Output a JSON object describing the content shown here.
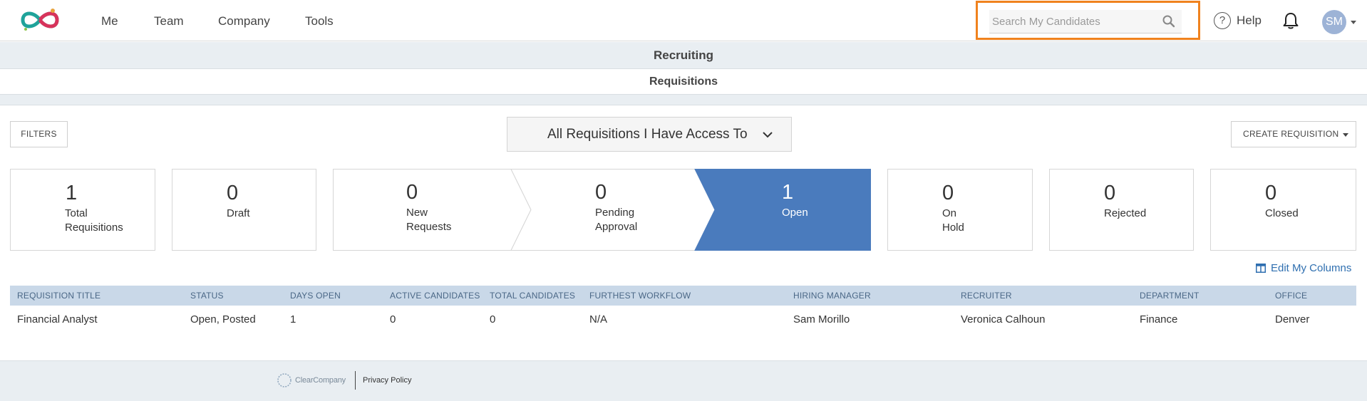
{
  "topnav": {
    "menu": [
      "Me",
      "Team",
      "Company",
      "Tools"
    ],
    "search_placeholder": "Search My Candidates",
    "help_label": "Help",
    "avatar_initials": "SM",
    "highlight_color": "#f0821e"
  },
  "header": {
    "title": "Recruiting",
    "subtitle": "Requisitions"
  },
  "toolbar": {
    "filters_label": "FILTERS",
    "view_selector": "All Requisitions I Have Access To",
    "create_label": "CREATE REQUISITION"
  },
  "stats": {
    "total": {
      "count": "1",
      "line1": "Total",
      "line2": "Requisitions"
    },
    "draft": {
      "count": "0",
      "line1": "Draft"
    },
    "closed_set": {
      "on_hold": {
        "count": "0",
        "line1": "On",
        "line2": "Hold"
      },
      "rejected": {
        "count": "0",
        "line1": "Rejected"
      },
      "closed": {
        "count": "0",
        "line1": "Closed"
      }
    }
  },
  "pipeline": {
    "new_requests": {
      "count": "0",
      "line1": "New",
      "line2": "Requests"
    },
    "pending_approval": {
      "count": "0",
      "line1": "Pending",
      "line2": "Approval"
    },
    "open": {
      "count": "1",
      "line1": "Open"
    },
    "active_color": "#4a7bbd"
  },
  "edit_columns_label": "Edit My Columns",
  "table": {
    "columns": [
      "REQUISITION TITLE",
      "STATUS",
      "DAYS OPEN",
      "ACTIVE CANDIDATES",
      "TOTAL CANDIDATES",
      "FURTHEST WORKFLOW",
      "HIRING MANAGER",
      "RECRUITER",
      "DEPARTMENT",
      "OFFICE"
    ],
    "rows": [
      [
        "Financial Analyst",
        "Open, Posted",
        "1",
        "0",
        "0",
        "N/A",
        "Sam Morillo",
        "Veronica Calhoun",
        "Finance",
        "Denver"
      ]
    ]
  },
  "footer": {
    "brand": "ClearCompany",
    "privacy_label": "Privacy Policy"
  }
}
